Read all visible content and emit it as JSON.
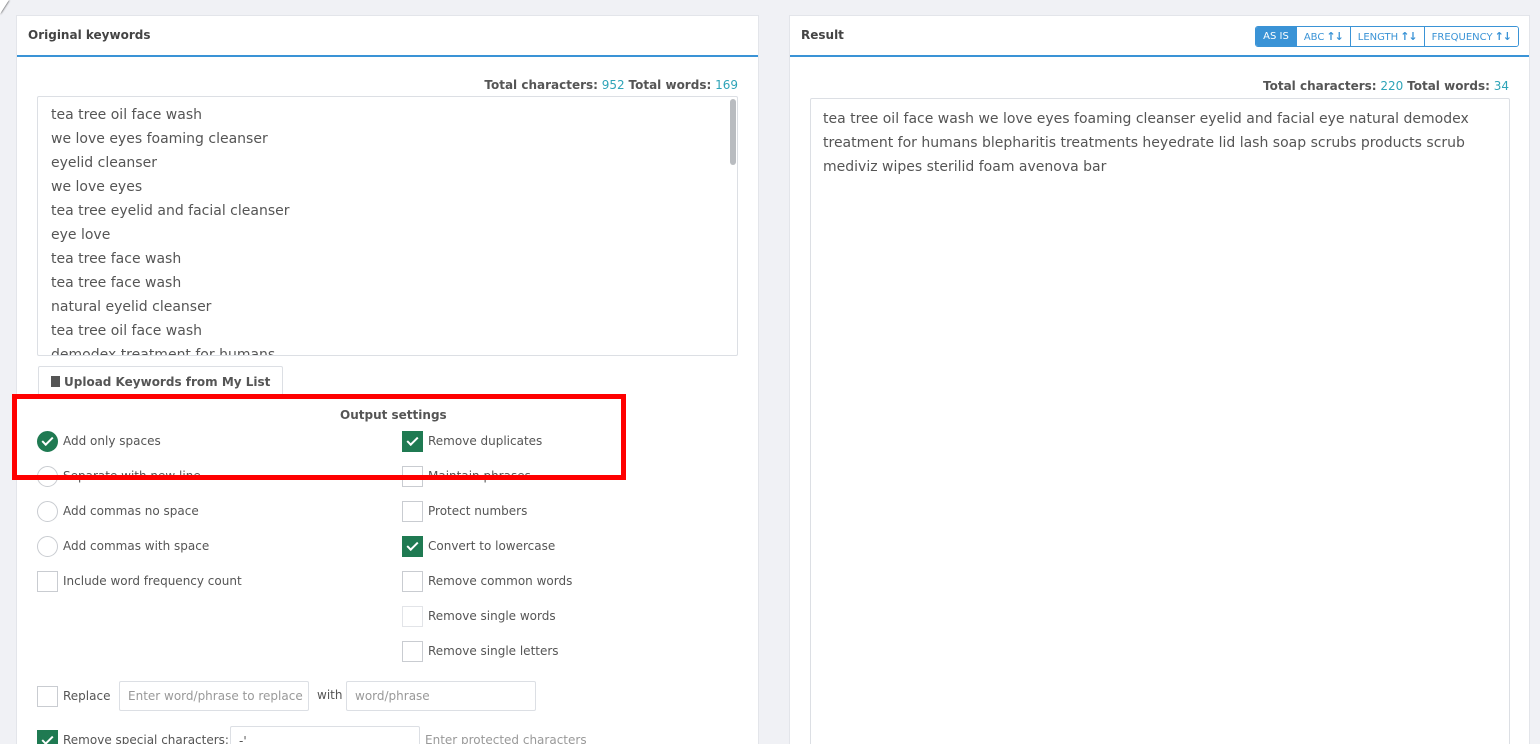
{
  "left_panel": {
    "title": "Original keywords",
    "stats": {
      "chars_label": "Total characters:",
      "chars": "952",
      "words_label": "Total words:",
      "words": "169"
    },
    "keywords": [
      "tea tree oil face wash",
      "we love eyes foaming cleanser",
      "eyelid cleanser",
      "we love eyes",
      "tea tree eyelid and facial cleanser",
      "eye love",
      "tea tree face wash",
      "tea tree face wash",
      "natural eyelid cleanser",
      "tea tree oil face wash",
      "demodex treatment for humans"
    ],
    "upload_label": "Upload Keywords from My List"
  },
  "settings": {
    "title": "Output settings",
    "left_options": [
      {
        "label": "Add only spaces",
        "type": "radio",
        "checked": true
      },
      {
        "label": "Separate with new line",
        "type": "radio",
        "checked": false
      },
      {
        "label": "Add commas no space",
        "type": "radio",
        "checked": false
      },
      {
        "label": "Add commas with space",
        "type": "radio",
        "checked": false
      },
      {
        "label": "Include word frequency count",
        "type": "checkbox",
        "checked": false
      }
    ],
    "right_options": [
      {
        "label": "Remove duplicates",
        "checked": true
      },
      {
        "label": "Maintain phrases",
        "checked": false
      },
      {
        "label": "Protect numbers",
        "checked": false
      },
      {
        "label": "Convert to lowercase",
        "checked": true
      },
      {
        "label": "Remove common words",
        "checked": false
      },
      {
        "label": "Remove single words",
        "checked": false
      },
      {
        "label": "Remove single letters",
        "checked": false
      }
    ],
    "replace": {
      "label": "Replace",
      "placeholder": "Enter word/phrase to replace",
      "with_label": "with",
      "with_placeholder": "word/phrase"
    },
    "special": {
      "label": "Remove special characters:",
      "value": "-'",
      "placeholder": "Enter protected characters"
    }
  },
  "right_panel": {
    "title": "Result",
    "sort_buttons": [
      {
        "label": "AS IS",
        "active": true,
        "arrows": ""
      },
      {
        "label": "ABC",
        "active": false,
        "arrows": "↑↓"
      },
      {
        "label": "LENGTH",
        "active": false,
        "arrows": "↑↓"
      },
      {
        "label": "FREQUENCY",
        "active": false,
        "arrows": "↑↓"
      }
    ],
    "stats": {
      "chars_label": "Total characters:",
      "chars": "220",
      "words_label": "Total words:",
      "words": "34"
    },
    "result_text": "tea tree oil face wash we love eyes foaming cleanser eyelid and facial eye natural demodex treatment for humans blepharitis treatments heyedrate lid lash soap scrubs products scrub mediviz wipes sterilid foam avenova bar"
  },
  "colors": {
    "accent": "#3a93d6",
    "check": "#1f7a52",
    "stat_number": "#2fa4b8",
    "highlight": "#ff0000"
  }
}
